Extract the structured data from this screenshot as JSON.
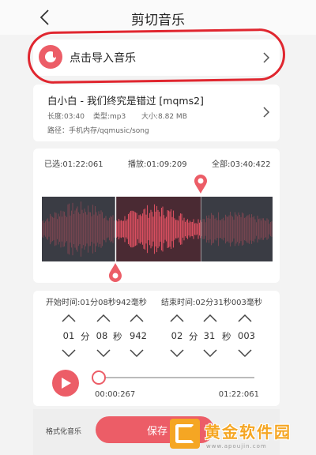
{
  "header": {
    "title": "剪切音乐"
  },
  "import": {
    "label": "点击导入音乐"
  },
  "song": {
    "title": "白小白 - 我们终究是错过 [mqms2]",
    "duration": "长度:03:40",
    "type": "类型:mp3",
    "size": "大小:8.82 MB",
    "path": "路径：手机内存/qqmusic/song"
  },
  "editor": {
    "selected": "已选:01:22:061",
    "playing": "播放:01:09:209",
    "total": "全部:03:40:422",
    "start_fraction": 0.32,
    "end_fraction": 0.69
  },
  "range": {
    "start_label": "开始时间:01分08秒942毫秒",
    "end_label": "结束时间:02分31秒003毫秒",
    "start": {
      "min": "01",
      "min_unit": "分",
      "sec": "08",
      "sec_unit": "秒",
      "ms": "942"
    },
    "end": {
      "min": "02",
      "min_unit": "分",
      "sec": "31",
      "sec_unit": "秒",
      "ms": "003"
    }
  },
  "player": {
    "current": "00:00:267",
    "end": "01:22:061",
    "progress": 0.0
  },
  "bottom": {
    "format_label": "格式化音乐",
    "save_label": "保存"
  },
  "watermark": {
    "brand": "黄金软件园",
    "url": "www.apoujin.com"
  },
  "colors": {
    "accent": "#ec5d67",
    "annotation": "#e0262f",
    "waveform_selected": "#d94f60",
    "waveform_unselected": "#3a3c44"
  }
}
